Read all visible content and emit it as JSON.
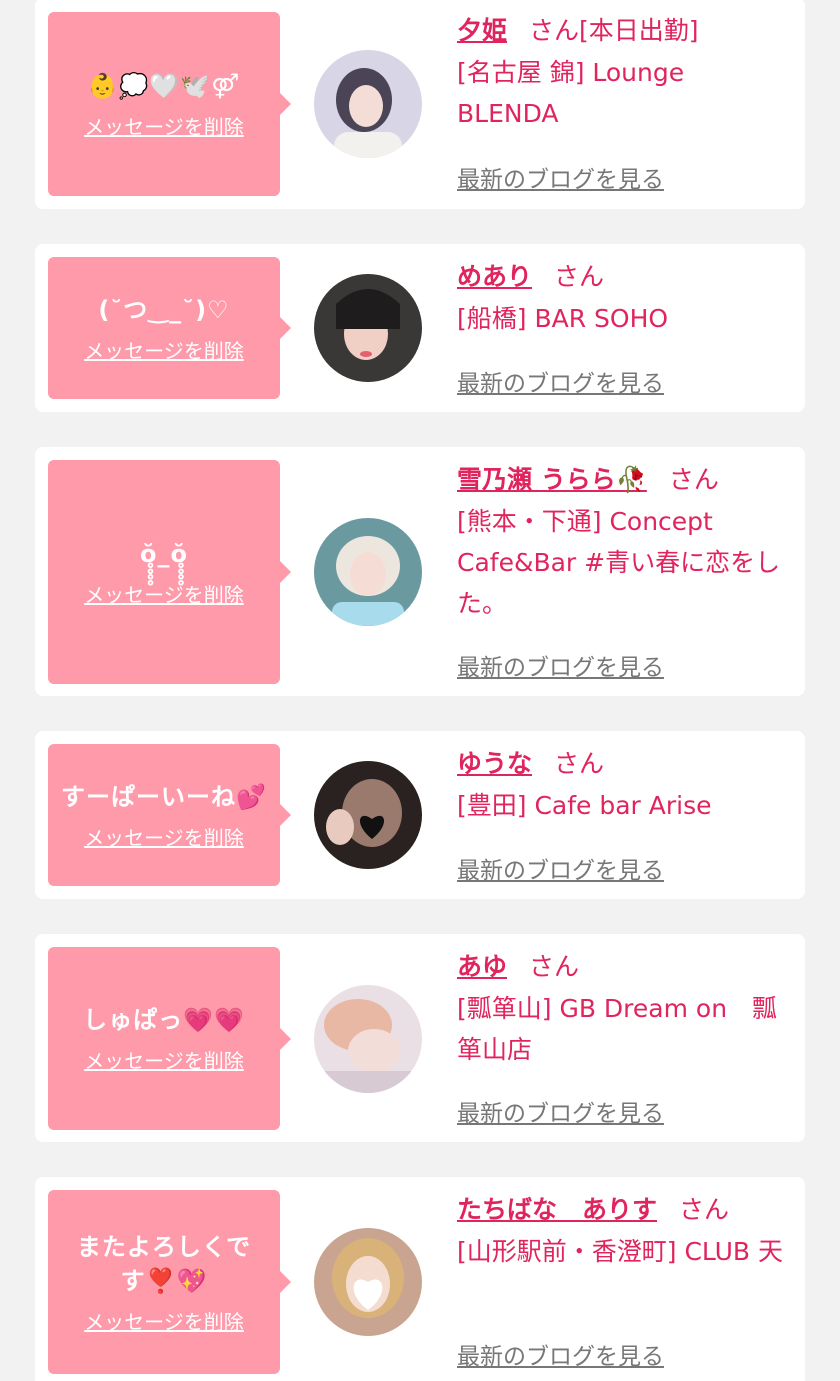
{
  "delete_label": "メッセージを削除",
  "blog_label": "最新のブログを見る",
  "san_label": "さん",
  "entries": [
    {
      "message": "👶💭🤍🕊️⚤",
      "name": "夕姫",
      "shop_prefix": "[本日出勤]",
      "shop": "[名古屋 錦] Lounge BLENDA"
    },
    {
      "message": "(˘つ‿_˘)♡",
      "name": "めあり",
      "shop_prefix": "",
      "shop": "[船橋] BAR SOHO"
    },
    {
      "message": "ŏ̥̥̥̥_ŏ̥̥̥̥",
      "name": "雪乃瀬 うらら🥀",
      "shop_prefix": "",
      "shop": "[熊本・下通] Concept Cafe&Bar #青い春に恋をした。"
    },
    {
      "message": "すーぱーいーね💕",
      "name": "ゆうな",
      "shop_prefix": "",
      "shop": "[豊田] Cafe bar Arise"
    },
    {
      "message": "しゅぱっ💗💗",
      "name": "あゆ",
      "shop_prefix": "",
      "shop": "[瓢箪山] GB Dream on　瓢箪山店"
    },
    {
      "message": "またよろしくです❣️💖",
      "name": "たちばな　ありす",
      "shop_prefix": "",
      "shop": "[山形駅前・香澄町] CLUB 天"
    }
  ]
}
